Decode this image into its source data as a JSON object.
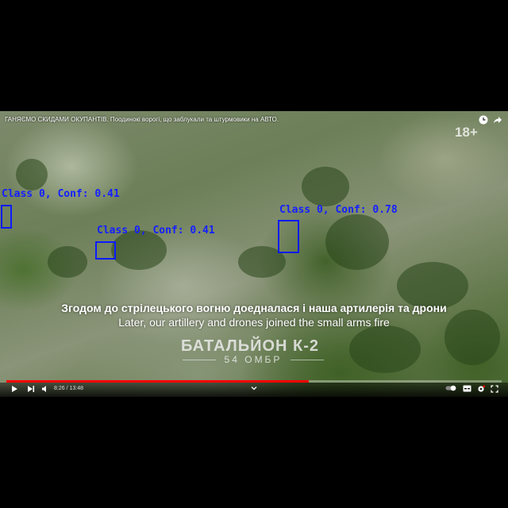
{
  "video": {
    "title": "ГАНЯЄМО СКИДАМИ ОКУПАНТІВ. Поодинокі ворогі, що заблукали та штурмовики на АВТО.",
    "age_rating": "18+",
    "subtitle_uk": "Згодом до стрілецького вогню доедналася і наша артилерія та дрони",
    "subtitle_en": "Later, our artillery and drones joined the small arms fire",
    "watermark_title": "БАТАЛЬЙОН К-2",
    "watermark_subtitle": "54 ОМБР",
    "time_display": "8:26 / 13:48",
    "progress_fraction": 0.61
  },
  "detections": [
    {
      "label": "Class 0, Conf: 0.41"
    },
    {
      "label": "Class 0, Conf: 0.41"
    },
    {
      "label": "Class 0, Conf: 0.78"
    }
  ],
  "icons": {
    "clock": "clock-icon",
    "share": "share-icon",
    "play": "play-icon",
    "next": "next-icon",
    "volume": "volume-icon",
    "chapter": "chevron-down-icon",
    "toggle": "autoplay-toggle-icon",
    "subtitles": "subtitles-icon",
    "settings": "settings-gear-icon",
    "fullscreen": "fullscreen-icon"
  },
  "colors": {
    "bbox": "#0b1bff",
    "progress": "#ff0000"
  }
}
